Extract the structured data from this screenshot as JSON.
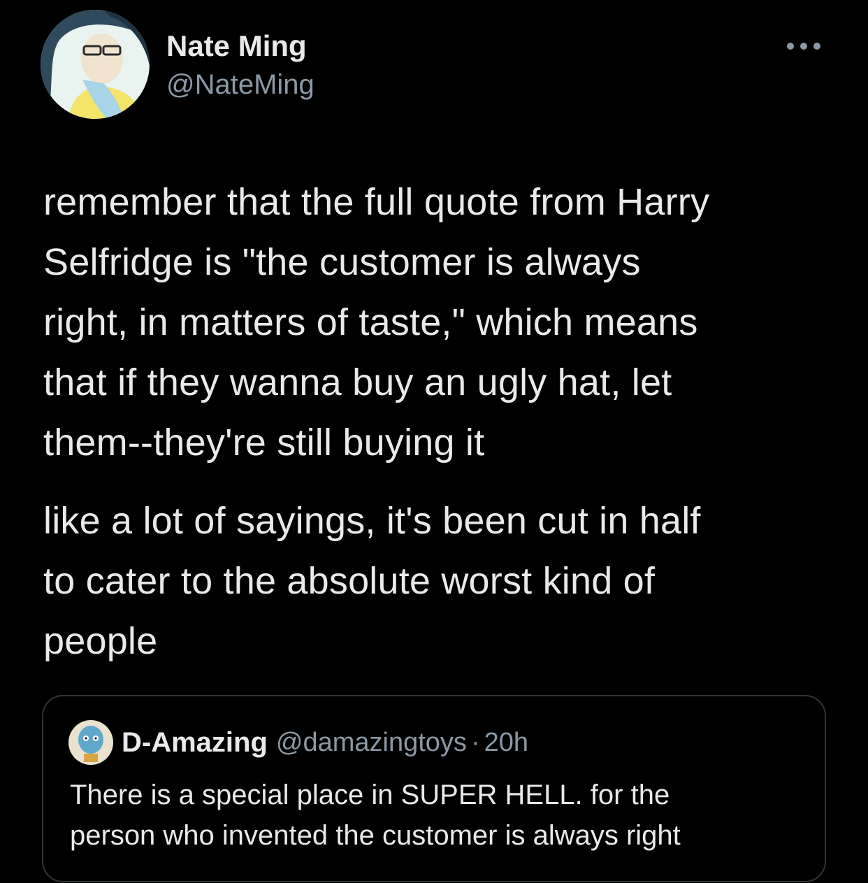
{
  "author": {
    "display_name": "Nate Ming",
    "handle": "@NateMing",
    "avatar_icon": "user-avatar"
  },
  "more_icon": "more-options-icon",
  "tweet": {
    "paragraphs": [
      "remember that the full quote from Harry\nSelfridge is \"the customer is always\nright, in matters of taste,\" which means\nthat if they wanna buy an ugly hat, let\nthem--they're still buying it",
      "like a lot of sayings, it's been cut in half\nto cater to the absolute worst kind of\npeople"
    ]
  },
  "quoted_tweet": {
    "display_name": "D-Amazing",
    "handle": "@damazingtoys",
    "separator": "·",
    "time": "20h",
    "avatar_icon": "quoted-user-avatar",
    "text": "There is a special place in SUPER HELL. for the\nperson who invented the customer is always right"
  },
  "colors": {
    "background": "#000000",
    "primary_text": "#e7e9ea",
    "secondary_text": "#8b98a5",
    "border": "#2f3336"
  }
}
